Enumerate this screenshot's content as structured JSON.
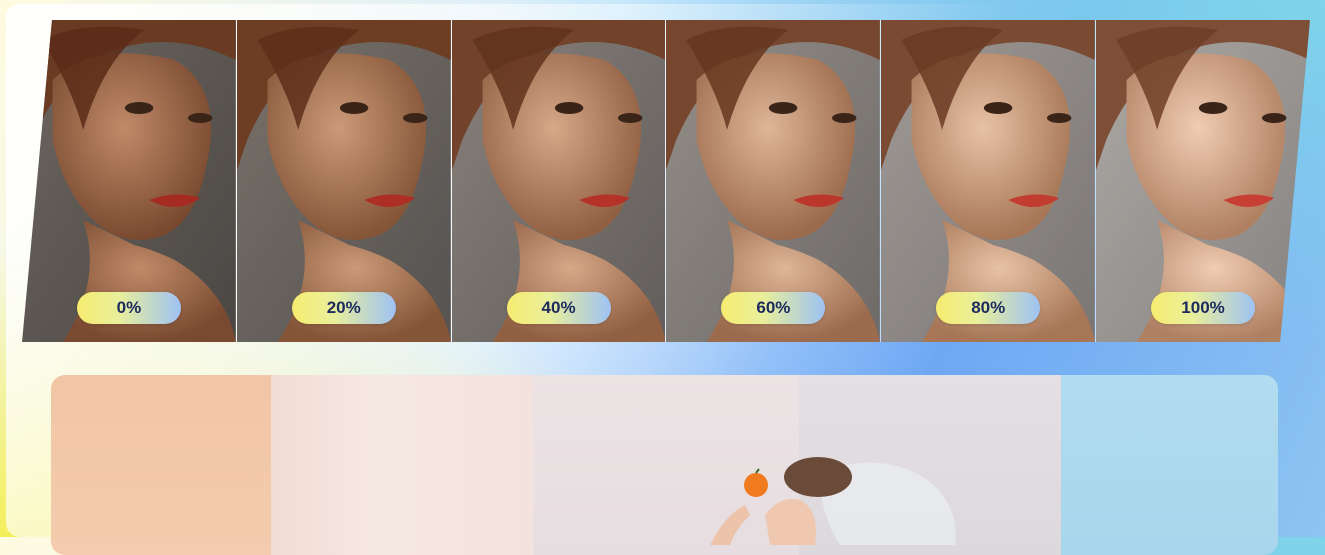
{
  "levels": [
    "0%",
    "20%",
    "40%",
    "60%",
    "80%",
    "100%"
  ],
  "colors": {
    "pill_text": "#1d2a5e",
    "pill_start": "#f6ec70",
    "pill_end": "#9ec2f4",
    "swatches": [
      "#f1c6a6",
      "#f4e4df",
      "#e8dfe2",
      "#e0dbdf",
      "#aed9ee"
    ]
  },
  "icons": [
    "portrait-photo",
    "orange-fruit"
  ]
}
